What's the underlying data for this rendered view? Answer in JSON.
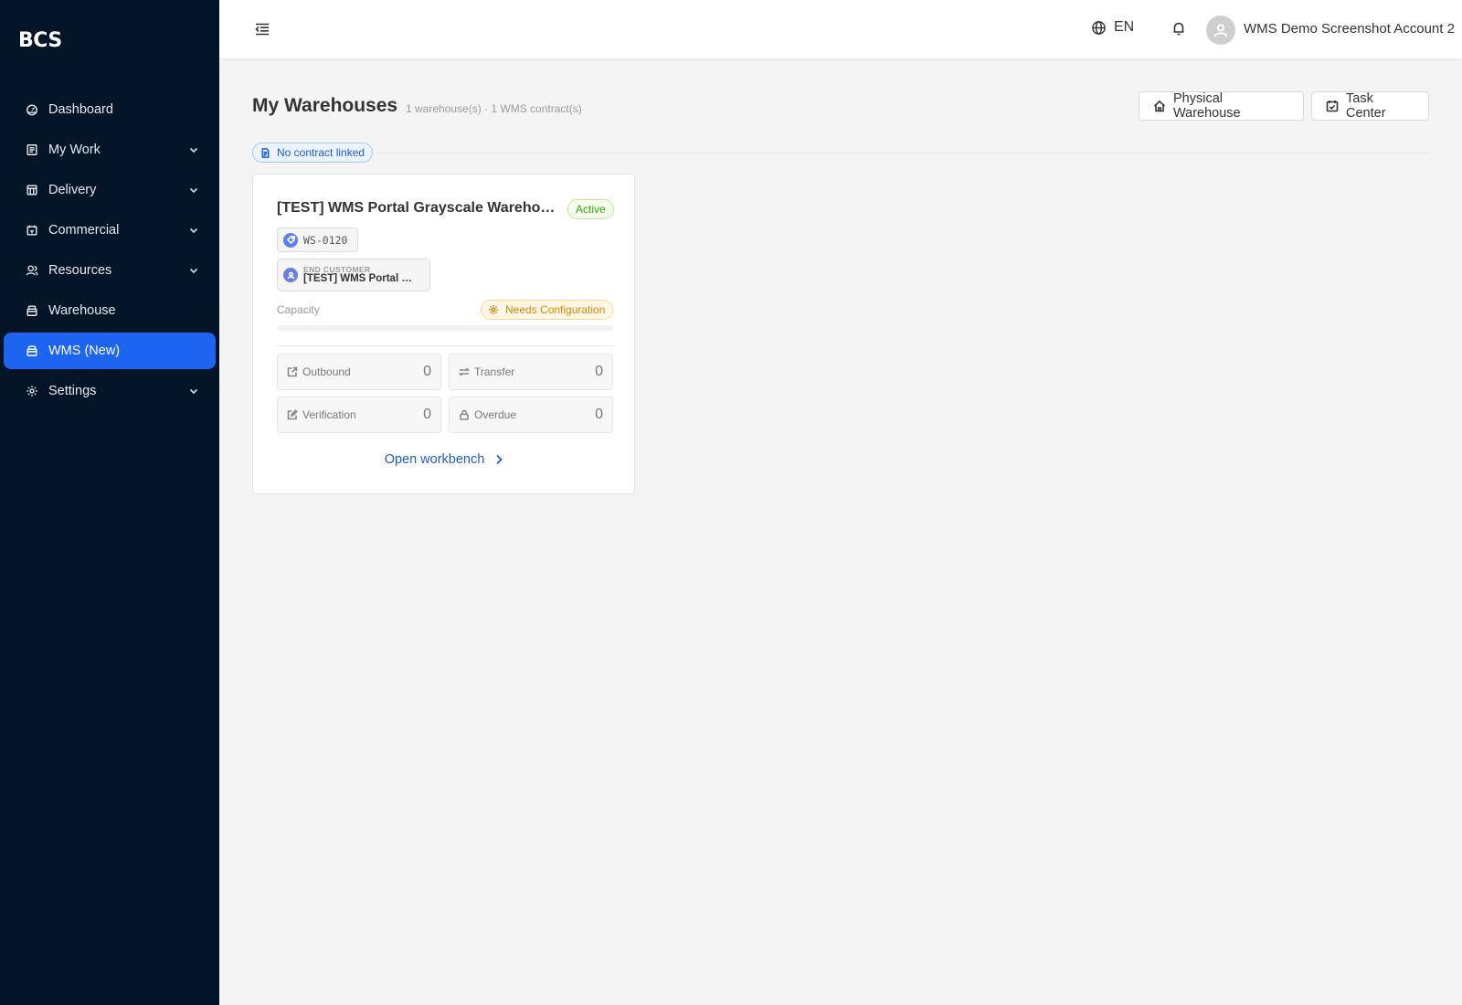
{
  "app": {
    "logo": "BCS"
  },
  "sidebar": {
    "items": [
      {
        "label": "Dashboard",
        "icon": "dashboard-icon",
        "expandable": false,
        "active": false
      },
      {
        "label": "My Work",
        "icon": "list-icon",
        "expandable": true,
        "active": false
      },
      {
        "label": "Delivery",
        "icon": "delivery-icon",
        "expandable": true,
        "active": false
      },
      {
        "label": "Commercial",
        "icon": "commercial-icon",
        "expandable": true,
        "active": false
      },
      {
        "label": "Resources",
        "icon": "users-icon",
        "expandable": true,
        "active": false
      },
      {
        "label": "Warehouse",
        "icon": "box-icon",
        "expandable": false,
        "active": false
      },
      {
        "label": "WMS (New)",
        "icon": "box-icon",
        "expandable": false,
        "active": true
      },
      {
        "label": "Settings",
        "icon": "gear-icon",
        "expandable": true,
        "active": false
      }
    ]
  },
  "header": {
    "language": "EN",
    "account_name": "WMS Demo Screenshot Account 2"
  },
  "page": {
    "title": "My Warehouses",
    "subtitle": "1 warehouse(s) · 1 WMS contract(s)",
    "buttons": {
      "physical": "Physical Warehouse",
      "task": "Task Center"
    },
    "contract_tag": "No contract linked"
  },
  "card": {
    "title": "[TEST] WMS Portal Grayscale Warehouse",
    "status": "Active",
    "code": "WS-0120",
    "customer_label": "END CUSTOMER",
    "customer_name": "[TEST] WMS Portal Grayscale Customer",
    "capacity_label": "Capacity",
    "capacity_status": "Needs Configuration",
    "capacity_fill_fraction": 0,
    "stats": {
      "outbound": {
        "label": "Outbound",
        "value": "0"
      },
      "transfer": {
        "label": "Transfer",
        "value": "0"
      },
      "verification": {
        "label": "Verification",
        "value": "0"
      },
      "overdue": {
        "label": "Overdue",
        "value": "0"
      }
    },
    "link": "Open workbench"
  },
  "colors": {
    "sidebar_bg": "#041527",
    "accent": "#1d65f0",
    "status_active": "#389e0d",
    "status_warning": "#d48806"
  }
}
